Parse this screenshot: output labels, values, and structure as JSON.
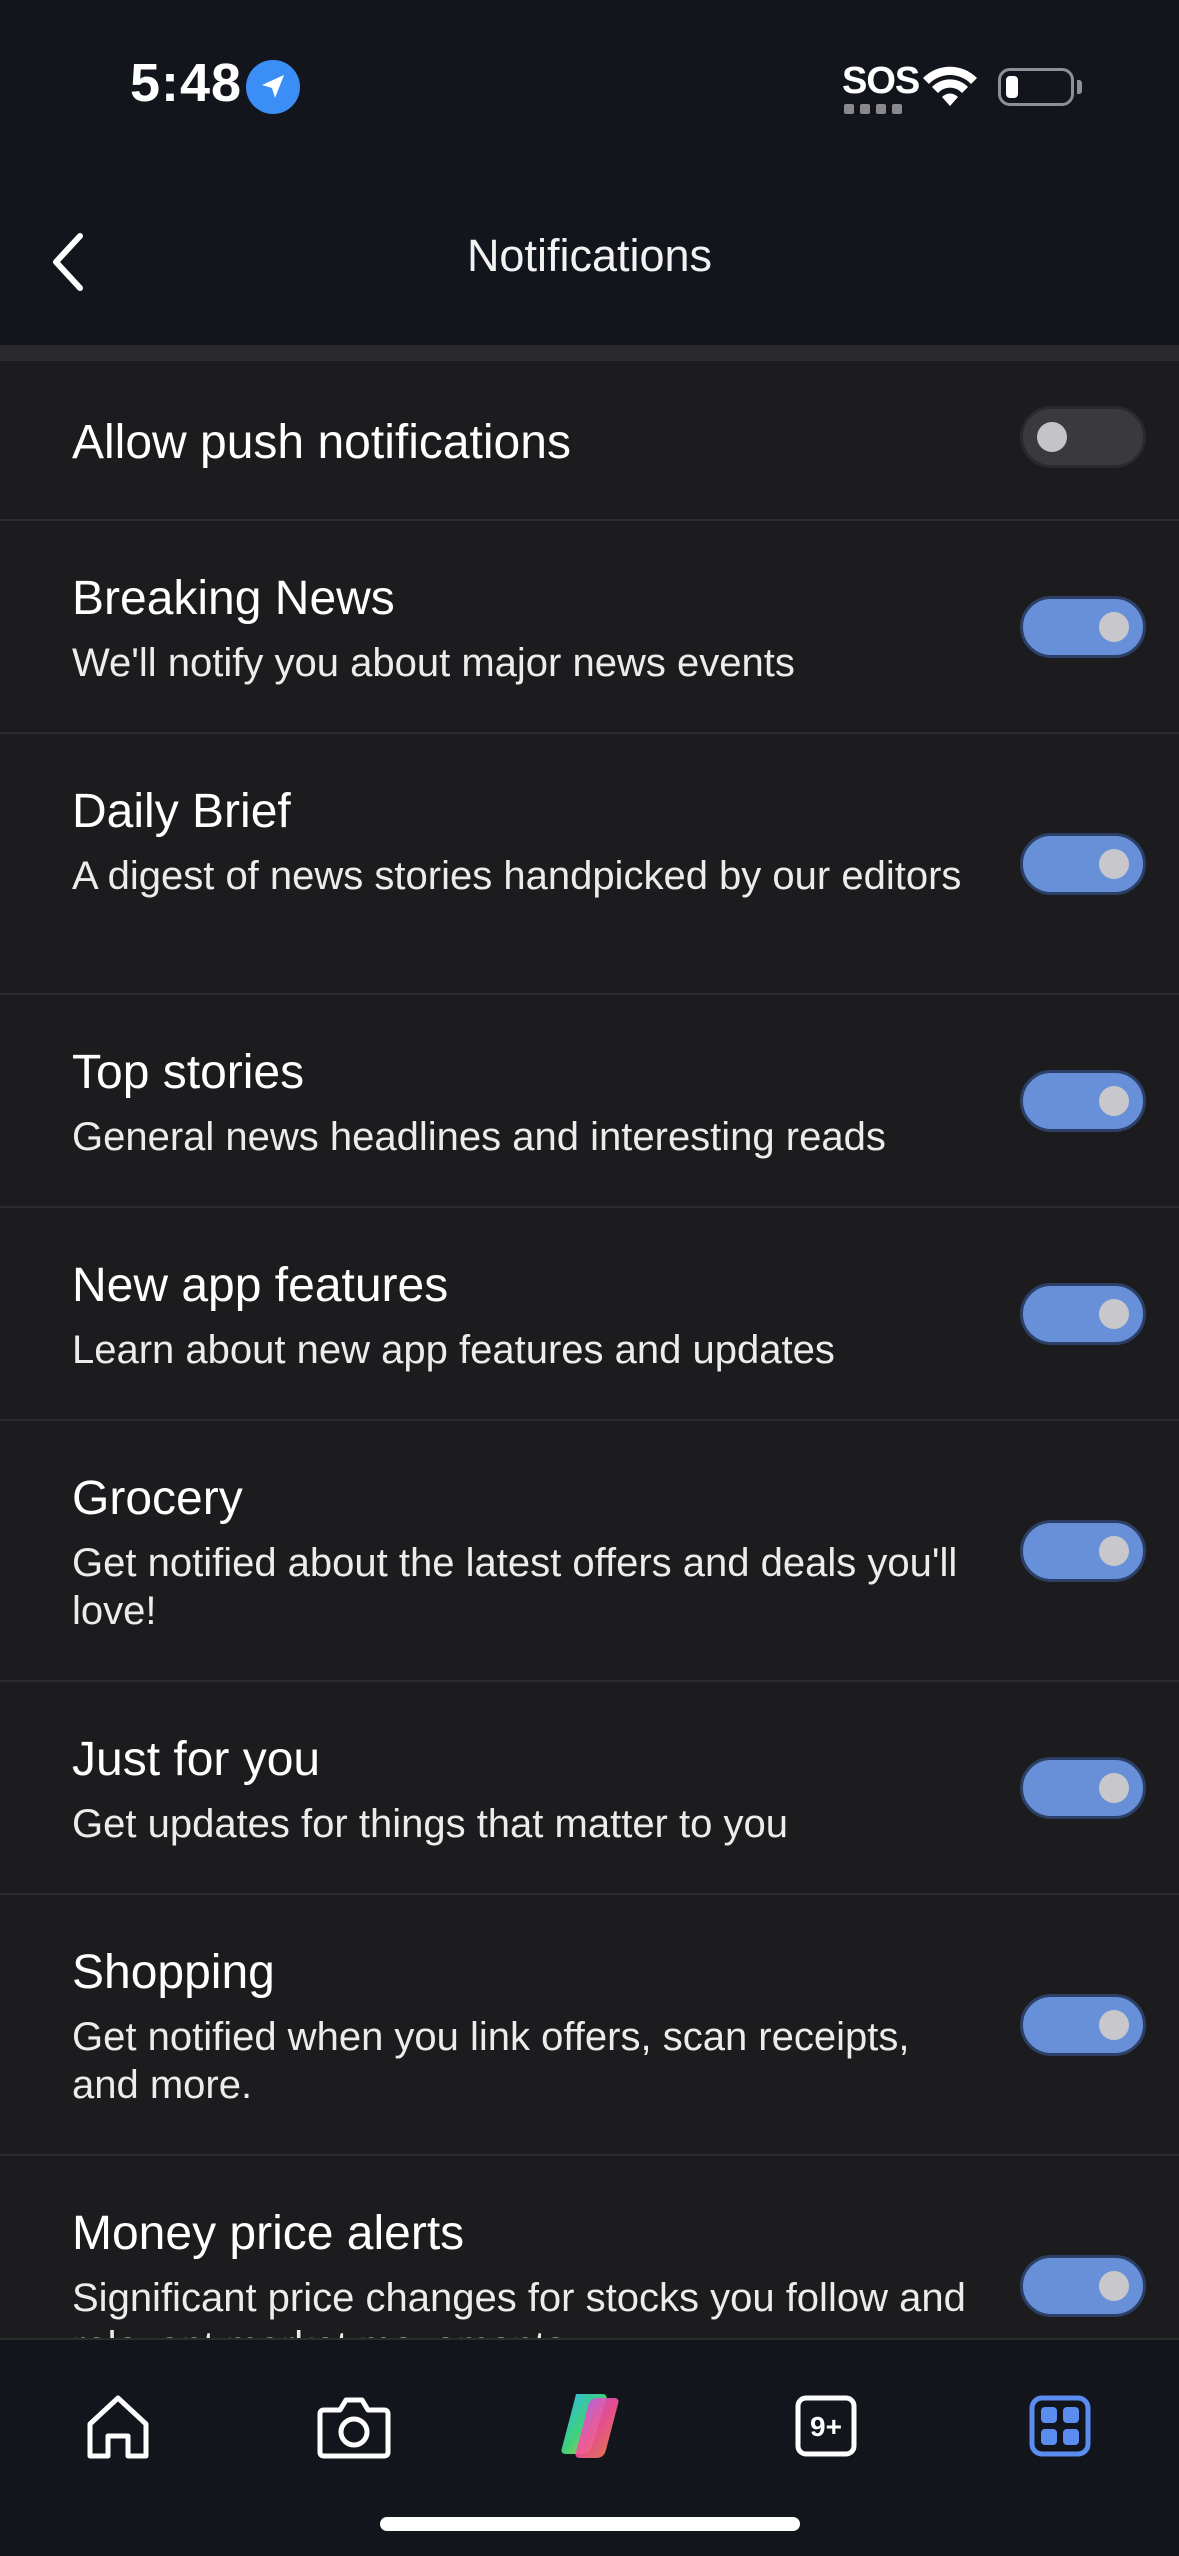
{
  "status_bar": {
    "time": "5:48",
    "sos": "SOS",
    "location_icon": "location-arrow-icon",
    "wifi_icon": "wifi-icon",
    "battery_icon": "battery-icon"
  },
  "header": {
    "title": "Notifications",
    "back_icon": "chevron-left-icon"
  },
  "settings": [
    {
      "title": "Allow push notifications",
      "description": "",
      "enabled": false
    },
    {
      "title": "Breaking News",
      "description": "We'll notify you about major news events",
      "enabled": true
    },
    {
      "title": "Daily Brief",
      "description": "A digest of news stories handpicked by our editors",
      "enabled": true
    },
    {
      "title": "Top stories",
      "description": "General news headlines and interesting reads",
      "enabled": true
    },
    {
      "title": "New app features",
      "description": "Learn about new app features and updates",
      "enabled": true
    },
    {
      "title": "Grocery",
      "description": "Get notified about the latest offers and deals you'll love!",
      "enabled": true
    },
    {
      "title": "Just for you",
      "description": "Get updates for things that matter to you",
      "enabled": true
    },
    {
      "title": "Shopping",
      "description": "Get notified when you link offers, scan receipts, and more.",
      "enabled": true
    },
    {
      "title": "Money price alerts",
      "description": "Significant price changes for stocks you follow and relevant market movements",
      "enabled": true
    }
  ],
  "tab_bar": {
    "tabs": [
      {
        "icon": "home-icon"
      },
      {
        "icon": "camera-icon"
      },
      {
        "icon": "copilot-icon"
      },
      {
        "icon": "tabs-count-icon",
        "badge": "9+"
      },
      {
        "icon": "apps-grid-icon"
      }
    ]
  },
  "colors": {
    "background": "#13151d",
    "list_background": "#1c1c1e",
    "toggle_on": "#6790d8",
    "toggle_off": "#3a3a3c",
    "accent_blue": "#3b8ef5"
  }
}
